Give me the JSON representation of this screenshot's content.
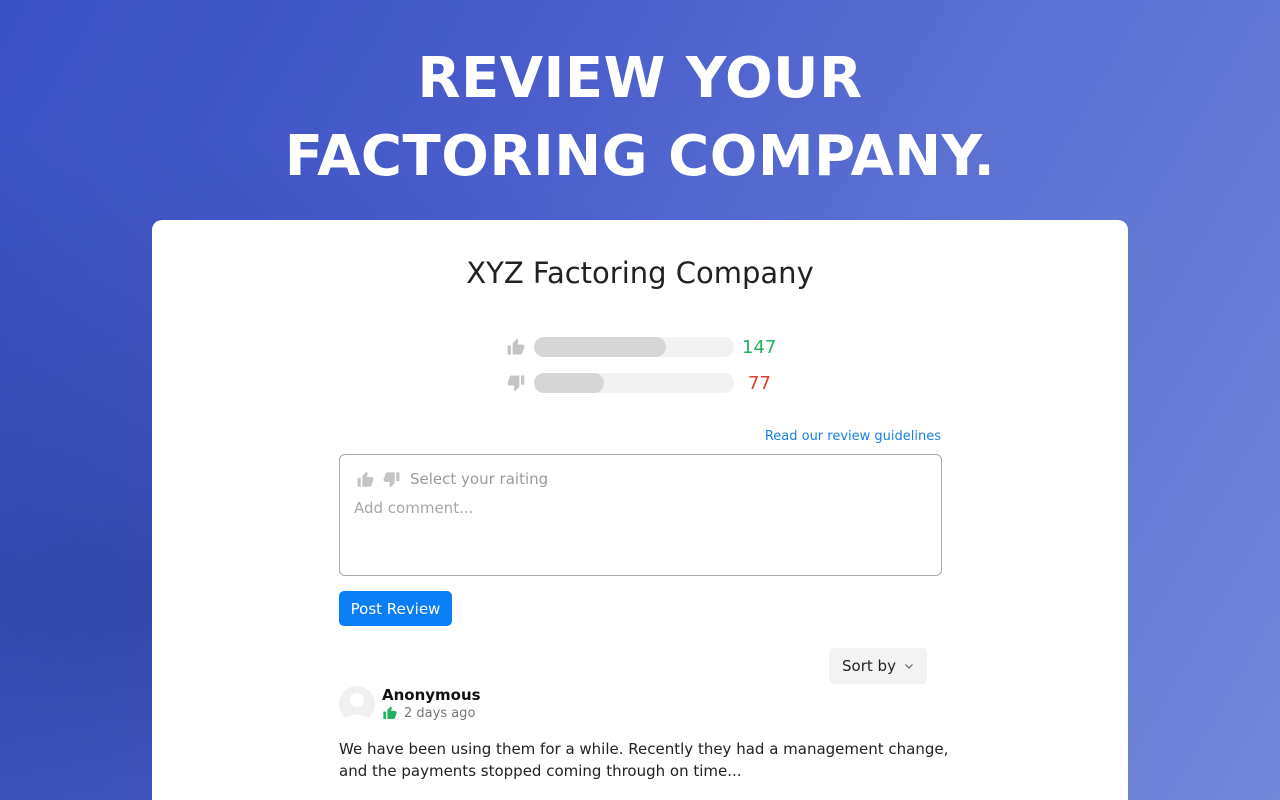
{
  "hero": {
    "line1": "REVIEW YOUR",
    "line2": "FACTORING COMPANY."
  },
  "company": {
    "name": "XYZ Factoring Company"
  },
  "stats": {
    "positive": {
      "count": "147",
      "fill_fraction": 0.66,
      "icon": "thumbs-up-icon"
    },
    "negative": {
      "count": "77",
      "fill_fraction": 0.35,
      "icon": "thumbs-down-icon"
    }
  },
  "form": {
    "guidelines_link": "Read our review guidelines",
    "rating_label": "Select your raiting",
    "comment_placeholder": "Add comment...",
    "submit_label": "Post Review"
  },
  "sort": {
    "label": "Sort by"
  },
  "reviews": [
    {
      "author": "Anonymous",
      "rating": "positive",
      "time": "2 days ago",
      "text": "We have been using them for a while. Recently they had a management change, and the payments stopped coming through on time..."
    }
  ],
  "colors": {
    "accent": "#0a7ef5",
    "positive": "#22b35e",
    "negative": "#e03b2e",
    "link": "#1a7fe0"
  }
}
